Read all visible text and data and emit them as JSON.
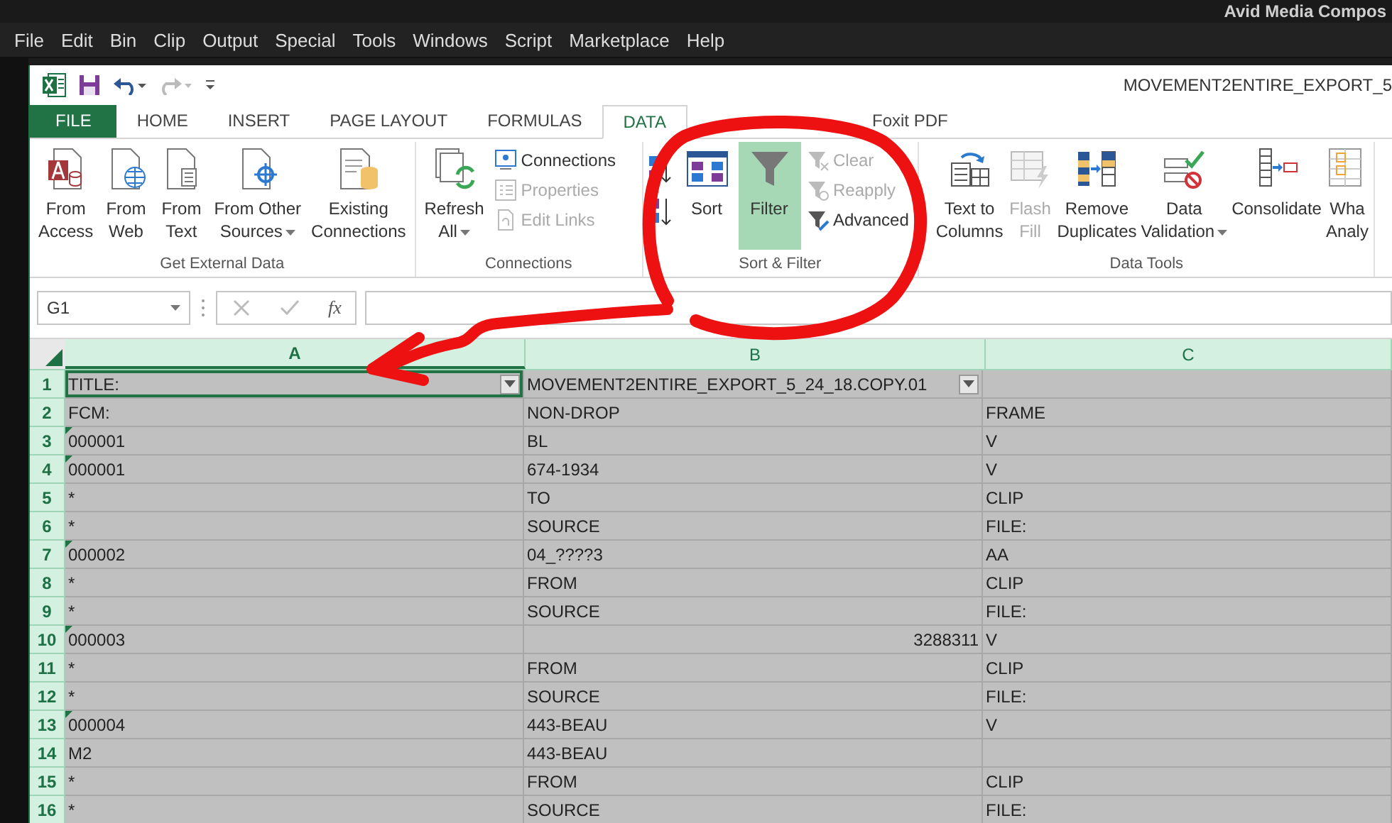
{
  "host_app": {
    "title": "Avid Media Compos",
    "menu": [
      "File",
      "Edit",
      "Bin",
      "Clip",
      "Output",
      "Special",
      "Tools",
      "Windows",
      "Script",
      "Marketplace",
      "Help"
    ]
  },
  "window": {
    "title": "MOVEMENT2ENTIRE_EXPORT_5"
  },
  "tabs": [
    {
      "label": "FILE",
      "kind": "file",
      "selected": false
    },
    {
      "label": "HOME",
      "kind": "tab",
      "selected": false
    },
    {
      "label": "INSERT",
      "kind": "tab",
      "selected": false
    },
    {
      "label": "PAGE LAYOUT",
      "kind": "tab",
      "selected": false
    },
    {
      "label": "FORMULAS",
      "kind": "tab",
      "selected": false
    },
    {
      "label": "DATA",
      "kind": "tab",
      "selected": true
    },
    {
      "label": "Foxit PDF",
      "kind": "tab",
      "selected": false
    }
  ],
  "ribbon": [
    {
      "label": "Get External Data",
      "items": [
        {
          "kind": "large",
          "lines": [
            "From",
            "Access"
          ],
          "disabled": false,
          "dropdown": false
        },
        {
          "kind": "large",
          "lines": [
            "From",
            "Web"
          ],
          "disabled": false,
          "dropdown": false
        },
        {
          "kind": "large",
          "lines": [
            "From",
            "Text"
          ],
          "disabled": false,
          "dropdown": false
        },
        {
          "kind": "large",
          "lines": [
            "From Other",
            "Sources"
          ],
          "disabled": false,
          "dropdown": true
        },
        {
          "kind": "large",
          "lines": [
            "Existing",
            "Connections"
          ],
          "disabled": false,
          "dropdown": false
        }
      ]
    },
    {
      "label": "Connections",
      "items": [
        {
          "kind": "large",
          "lines": [
            "Refresh",
            "All"
          ],
          "disabled": false,
          "dropdown": true
        },
        {
          "kind": "stack",
          "entries": [
            {
              "label": "Connections",
              "disabled": false
            },
            {
              "label": "Properties",
              "disabled": true
            },
            {
              "label": "Edit Links",
              "disabled": true
            }
          ]
        }
      ]
    },
    {
      "label": "Sort & Filter",
      "items": [
        {
          "kind": "sortpair"
        },
        {
          "kind": "large",
          "lines": [
            "Sort"
          ],
          "disabled": false,
          "dropdown": false
        },
        {
          "kind": "large",
          "lines": [
            "Filter"
          ],
          "disabled": false,
          "dropdown": false,
          "on": true
        },
        {
          "kind": "stack",
          "entries": [
            {
              "label": "Clear",
              "disabled": true
            },
            {
              "label": "Reapply",
              "disabled": true
            },
            {
              "label": "Advanced",
              "disabled": false
            }
          ]
        }
      ]
    },
    {
      "label": "Data Tools",
      "items": [
        {
          "kind": "large",
          "lines": [
            "Text to",
            "Columns"
          ],
          "disabled": false,
          "dropdown": false
        },
        {
          "kind": "large",
          "lines": [
            "Flash",
            "Fill"
          ],
          "disabled": true,
          "dropdown": false
        },
        {
          "kind": "large",
          "lines": [
            "Remove",
            "Duplicates"
          ],
          "disabled": false,
          "dropdown": false
        },
        {
          "kind": "large",
          "lines": [
            "Data",
            "Validation"
          ],
          "disabled": false,
          "dropdown": true
        },
        {
          "kind": "large",
          "lines": [
            "Consolidate"
          ],
          "disabled": false,
          "dropdown": false
        },
        {
          "kind": "large",
          "lines": [
            "Wha",
            "Analy"
          ],
          "disabled": false,
          "dropdown": false
        }
      ]
    }
  ],
  "formula_bar": {
    "name_box": "G1",
    "function_label": "fx"
  },
  "columns": [
    {
      "label": "A",
      "selected": true
    },
    {
      "label": "B",
      "selected": false
    },
    {
      "label": "C",
      "selected": false
    }
  ],
  "rows": [
    {
      "num": "1",
      "marked": false,
      "filters": true,
      "cells": [
        {
          "t": "TITLE:",
          "kind": "text"
        },
        {
          "t": "MOVEMENT2ENTIRE_EXPORT_5_24_18.COPY.01",
          "kind": "text"
        }
      ]
    },
    {
      "num": "2",
      "marked": false,
      "filters": false,
      "cells": [
        {
          "t": "FCM:",
          "kind": "text"
        },
        {
          "t": "NON-DROP",
          "kind": "text"
        },
        {
          "t": "FRAME",
          "kind": "text"
        }
      ]
    },
    {
      "num": "3",
      "marked": true,
      "filters": false,
      "cells": [
        {
          "t": "000001",
          "kind": "text"
        },
        {
          "t": "BL",
          "kind": "text"
        },
        {
          "t": "V",
          "kind": "text"
        }
      ]
    },
    {
      "num": "4",
      "marked": true,
      "filters": false,
      "cells": [
        {
          "t": "000001",
          "kind": "text"
        },
        {
          "t": "674-1934",
          "kind": "text"
        },
        {
          "t": "V",
          "kind": "text"
        }
      ]
    },
    {
      "num": "5",
      "marked": false,
      "filters": false,
      "cells": [
        {
          "t": "*",
          "kind": "text"
        },
        {
          "t": "TO",
          "kind": "text"
        },
        {
          "t": "CLIP",
          "kind": "text"
        }
      ]
    },
    {
      "num": "6",
      "marked": false,
      "filters": false,
      "cells": [
        {
          "t": "*",
          "kind": "text"
        },
        {
          "t": "SOURCE",
          "kind": "text"
        },
        {
          "t": "FILE:",
          "kind": "text"
        }
      ]
    },
    {
      "num": "7",
      "marked": true,
      "filters": false,
      "cells": [
        {
          "t": "000002",
          "kind": "text"
        },
        {
          "t": "04_????3",
          "kind": "text"
        },
        {
          "t": "AA",
          "kind": "text"
        }
      ]
    },
    {
      "num": "8",
      "marked": false,
      "filters": false,
      "cells": [
        {
          "t": "*",
          "kind": "text"
        },
        {
          "t": "FROM",
          "kind": "text"
        },
        {
          "t": "CLIP",
          "kind": "text"
        }
      ]
    },
    {
      "num": "9",
      "marked": false,
      "filters": false,
      "cells": [
        {
          "t": "*",
          "kind": "text"
        },
        {
          "t": "SOURCE",
          "kind": "text"
        },
        {
          "t": "FILE:",
          "kind": "text"
        }
      ]
    },
    {
      "num": "10",
      "marked": true,
      "filters": false,
      "cells": [
        {
          "t": "000003",
          "kind": "text"
        },
        {
          "t": "3288311",
          "kind": "number"
        },
        {
          "t": "V",
          "kind": "text"
        }
      ]
    },
    {
      "num": "11",
      "marked": false,
      "filters": false,
      "cells": [
        {
          "t": "*",
          "kind": "text"
        },
        {
          "t": "FROM",
          "kind": "text"
        },
        {
          "t": "CLIP",
          "kind": "text"
        }
      ]
    },
    {
      "num": "12",
      "marked": false,
      "filters": false,
      "cells": [
        {
          "t": "*",
          "kind": "text"
        },
        {
          "t": "SOURCE",
          "kind": "text"
        },
        {
          "t": "FILE:",
          "kind": "text"
        }
      ]
    },
    {
      "num": "13",
      "marked": true,
      "filters": false,
      "cells": [
        {
          "t": "000004",
          "kind": "text"
        },
        {
          "t": "443-BEAU",
          "kind": "text"
        },
        {
          "t": "V",
          "kind": "text"
        }
      ]
    },
    {
      "num": "14",
      "marked": false,
      "filters": false,
      "cells": [
        {
          "t": "M2",
          "kind": "text"
        },
        {
          "t": "443-BEAU",
          "kind": "text"
        }
      ]
    },
    {
      "num": "15",
      "marked": false,
      "filters": false,
      "cells": [
        {
          "t": "*",
          "kind": "text"
        },
        {
          "t": "FROM",
          "kind": "text"
        },
        {
          "t": "CLIP",
          "kind": "text"
        }
      ]
    },
    {
      "num": "16",
      "marked": false,
      "filters": false,
      "cells": [
        {
          "t": "*",
          "kind": "text"
        },
        {
          "t": "SOURCE",
          "kind": "text"
        },
        {
          "t": "FILE:",
          "kind": "text"
        }
      ]
    }
  ]
}
